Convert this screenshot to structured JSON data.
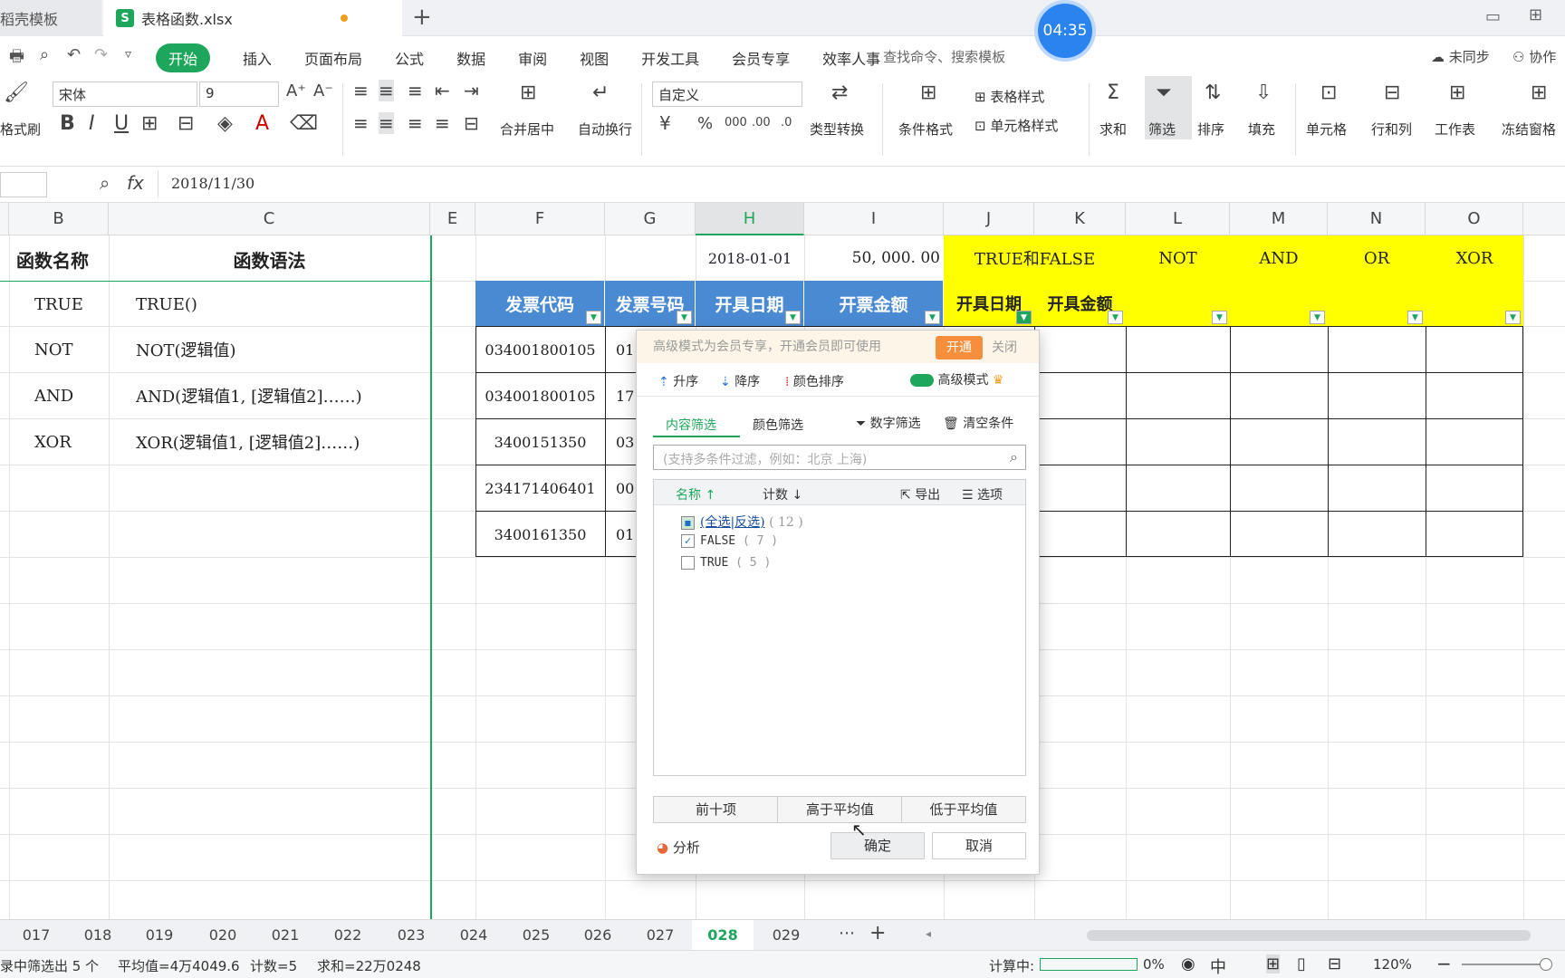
{
  "tabs": {
    "templates": "稻壳模板",
    "active_file": "表格函数.xlsx",
    "xls_icon": "S"
  },
  "clock": "04:35",
  "menu": {
    "items": [
      "开始",
      "插入",
      "页面布局",
      "公式",
      "数据",
      "审阅",
      "视图",
      "开发工具",
      "会员专享",
      "效率人事"
    ],
    "search": "查找命令、搜索模板",
    "sync": "未同步",
    "collab": "协作"
  },
  "ribbon": {
    "format_painter": "格式刷",
    "font_name": "宋体",
    "font_size": "9",
    "merge": "合并居中",
    "wrap": "自动换行",
    "number_format": "自定义",
    "type_convert": "类型转换",
    "cond_format": "条件格式",
    "table_style": "表格样式",
    "cell_style": "单元格样式",
    "sum": "求和",
    "filter": "筛选",
    "sort": "排序",
    "fill": "填充",
    "cell": "单元格",
    "rowcol": "行和列",
    "worksheet": "工作表",
    "freeze": "冻结窗格"
  },
  "formula": {
    "fx": "fx",
    "value": "2018/11/30"
  },
  "columns": [
    "B",
    "C",
    "E",
    "F",
    "G",
    "H",
    "I",
    "J",
    "K",
    "L",
    "M",
    "N",
    "O"
  ],
  "left_table": {
    "header": {
      "name": "函数名称",
      "syntax": "函数语法"
    },
    "rows": [
      {
        "name": "TRUE",
        "syntax": "TRUE()"
      },
      {
        "name": "NOT",
        "syntax": "NOT(逻辑值)"
      },
      {
        "name": "AND",
        "syntax": "AND(逻辑值1, [逻辑值2]……)"
      },
      {
        "name": "XOR",
        "syntax": "XOR(逻辑值1, [逻辑值2]……)"
      }
    ]
  },
  "row2": {
    "date": "2018-01-01",
    "amount": "50, 000. 00",
    "tf": "TRUE和FALSE",
    "not": "NOT",
    "and": "AND",
    "or": "OR",
    "xor": "XOR"
  },
  "invoice_headers": [
    "发票代码",
    "发票号码",
    "开具日期",
    "开票金额",
    "开具日期",
    "开具金额"
  ],
  "invoice_rows": [
    {
      "code": "034001800105",
      "num": "01"
    },
    {
      "code": "034001800105",
      "num": "17"
    },
    {
      "code": "3400151350",
      "num": "03"
    },
    {
      "code": "234171406401",
      "num": "00"
    },
    {
      "code": "3400161350",
      "num": "01"
    }
  ],
  "filter_popup": {
    "vip_text": "高级模式为会员专享，开通会员即可使用",
    "vip_open": "开通",
    "vip_close": "关闭",
    "asc": "升序",
    "desc": "降序",
    "color_sort": "颜色排序",
    "advanced": "高级模式",
    "tab_content": "内容筛选",
    "tab_color": "颜色筛选",
    "num_filter": "数字筛选",
    "clear": "清空条件",
    "search_placeholder": "(支持多条件过滤，例如：北京 上海)",
    "col_name": "名称",
    "col_count": "计数",
    "export": "导出",
    "options": "选项",
    "items": [
      {
        "label": "(全选|反选)",
        "count": "( 12 )",
        "state": "partial"
      },
      {
        "label": "FALSE",
        "count": "( 7 )",
        "state": "checked"
      },
      {
        "label": "TRUE",
        "count": "( 5 )",
        "state": "unchecked"
      }
    ],
    "top10": "前十项",
    "above_avg": "高于平均值",
    "below_avg": "低于平均值",
    "analyze": "分析",
    "ok": "确定",
    "cancel": "取消"
  },
  "sheets": [
    "017",
    "018",
    "019",
    "020",
    "021",
    "022",
    "023",
    "024",
    "025",
    "026",
    "027",
    "028",
    "029"
  ],
  "active_sheet": "028",
  "status": {
    "filtered": "录中筛选出 5 个",
    "avg": "平均值=4万4049.6",
    "count": "计数=5",
    "sum": "求和=22万0248",
    "calc": "计算中:",
    "pct": "0%",
    "zoom": "120%"
  }
}
